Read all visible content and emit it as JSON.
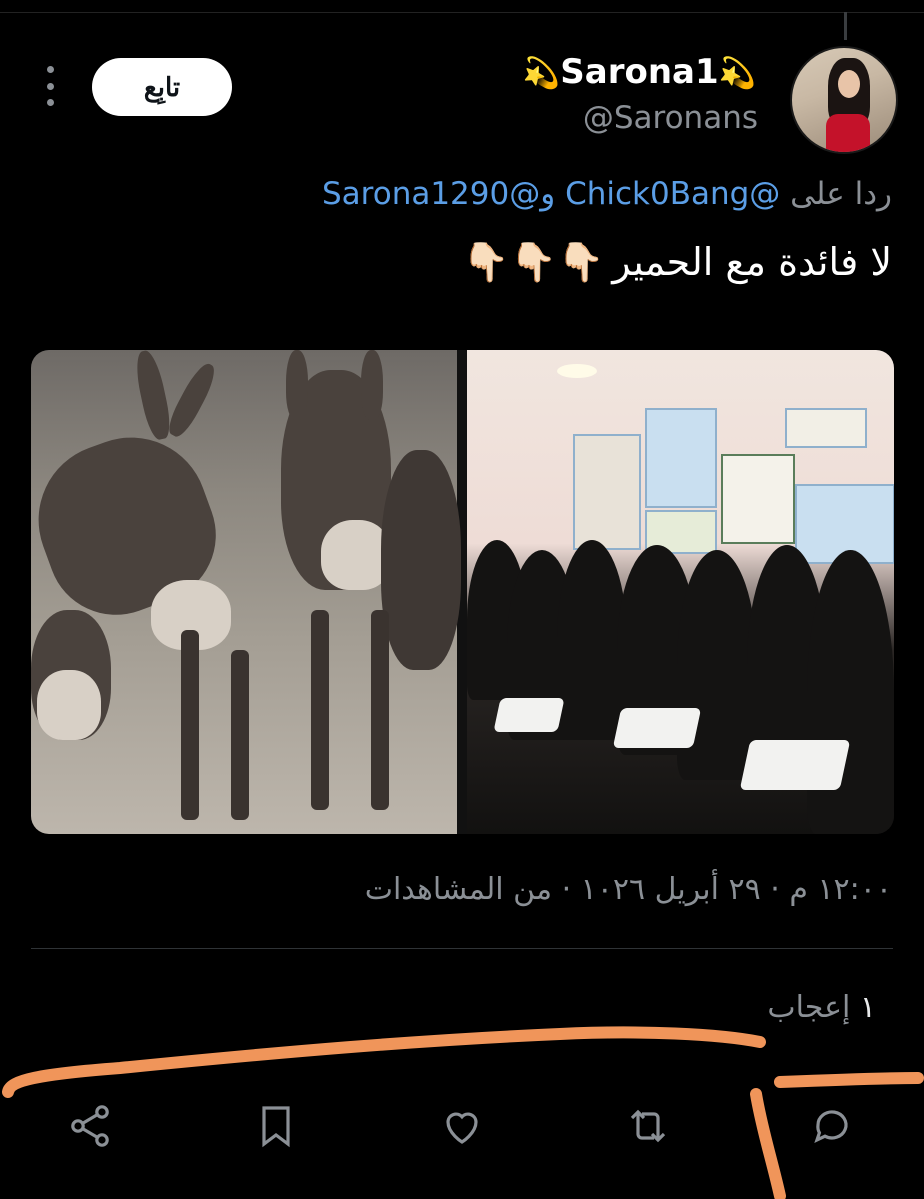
{
  "tweet": {
    "display_name": "Sarona1",
    "name_emoji": "💫",
    "handle": "@Saronans",
    "follow_label": "تابِع",
    "reply_prefix": "ردا على",
    "mention_1": "@Chick0Bang",
    "mention_conj": "و",
    "mention_2": "@Sarona1290",
    "text": "لا فائدة مع الحمير",
    "text_emoji": "👇🏻👇🏻👇🏻",
    "meta": "١٢:٠٠ م · ٢٩ أبريل ١٠٢٦ · من المشاهدات",
    "likes_count": "١",
    "likes_label": "إعجاب"
  },
  "icons": [
    "more-icon",
    "reply-icon",
    "retweet-icon",
    "like-icon",
    "bookmark-icon",
    "share-icon"
  ],
  "colors": {
    "background": "#000000",
    "text": "#e7e9ea",
    "muted": "#8b9096",
    "mention": "#5b9ee6",
    "annotation": "#f0955a"
  }
}
